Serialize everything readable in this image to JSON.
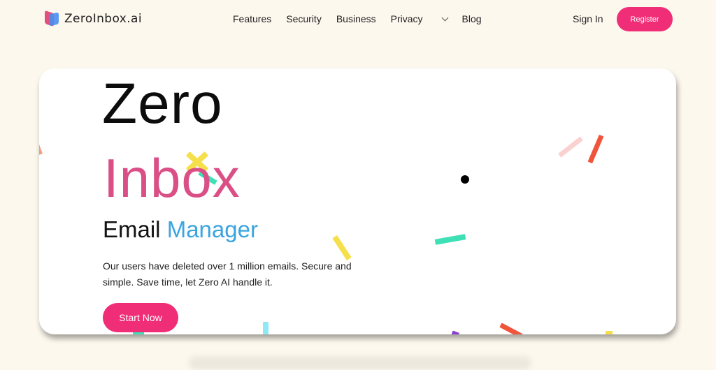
{
  "brand": {
    "name": "ZeroInbox.ai"
  },
  "nav": {
    "links": [
      "Features",
      "Security",
      "Business",
      "Privacy",
      "Blog"
    ],
    "signin": "Sign In",
    "register": "Register"
  },
  "hero": {
    "title_line1": "Zero",
    "title_line2": "Inbox",
    "subtitle_part1": "Email",
    "subtitle_part2": "Manager",
    "description": "Our users have deleted over 1 million emails. Secure and simple. Save time, let Zero AI handle it.",
    "cta": "Start Now"
  },
  "colors": {
    "accent": "#f02d77",
    "inbox_pink": "#d94f86",
    "manager_blue": "#3aa5e0",
    "background": "#fdf8ee"
  },
  "icons": [
    "zeroinbox-logo-icon",
    "chevron-down-icon"
  ]
}
